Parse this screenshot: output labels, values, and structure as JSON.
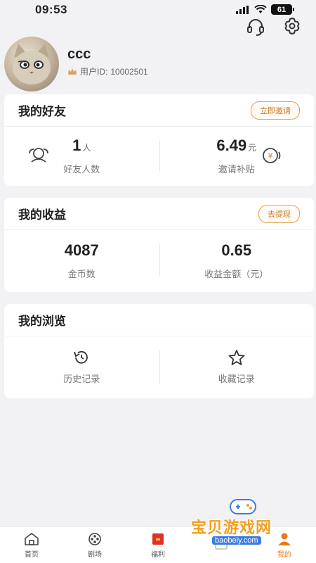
{
  "status_bar": {
    "time": "09:53",
    "battery": "61"
  },
  "profile": {
    "username": "ccc",
    "user_id_label": "用户ID:",
    "user_id": "10002501"
  },
  "friends": {
    "title": "我的好友",
    "action_label": "立即邀请",
    "count": "1",
    "count_unit": "人",
    "count_label": "好友人数",
    "subsidy": "6.49",
    "subsidy_unit": "元",
    "subsidy_label": "邀请补贴"
  },
  "earnings": {
    "title": "我的收益",
    "action_label": "去提现",
    "coins": "4087",
    "coins_label": "金币数",
    "amount": "0.65",
    "amount_label": "收益金额（元）"
  },
  "browsing": {
    "title": "我的浏览",
    "history_label": "历史记录",
    "favorites_label": "收藏记录"
  },
  "bottom_nav": [
    {
      "label": "首页",
      "icon": "home-icon"
    },
    {
      "label": "剧场",
      "icon": "film-reel-icon"
    },
    {
      "label": "福利",
      "icon": "gift-icon"
    },
    {
      "label": "",
      "icon": "task-icon"
    },
    {
      "label": "我的",
      "icon": "profile-icon"
    }
  ],
  "watermark": {
    "text": "宝贝游戏网",
    "url": "baobeiy.com"
  },
  "colors": {
    "accent": "#e67a1a",
    "pill_border": "#e0a055",
    "background": "#f2f2f4",
    "card": "#ffffff"
  }
}
